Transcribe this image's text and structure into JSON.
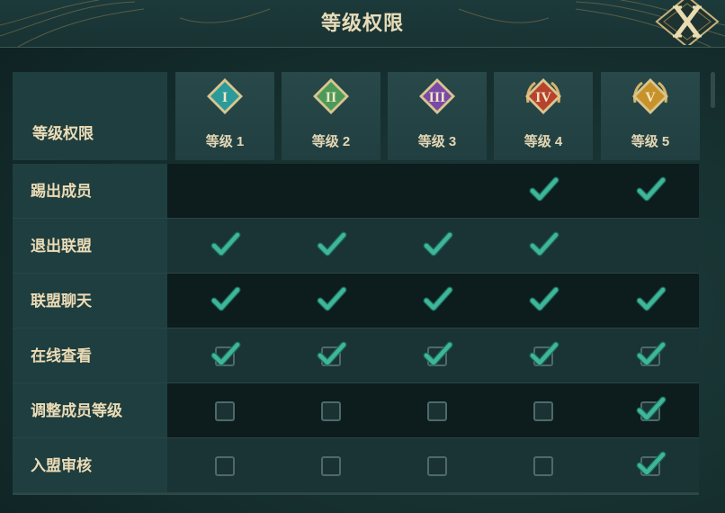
{
  "title": "等级权限",
  "close_label": "X",
  "header_label": "等级权限",
  "levels": [
    {
      "label": "等级 1",
      "numeral": "I",
      "color": "#2a9a9a"
    },
    {
      "label": "等级 2",
      "numeral": "II",
      "color": "#4c9a5a"
    },
    {
      "label": "等级 3",
      "numeral": "III",
      "color": "#7a4aa6"
    },
    {
      "label": "等级 4",
      "numeral": "IV",
      "color": "#b7432d"
    },
    {
      "label": "等级 5",
      "numeral": "V",
      "color": "#c8922b"
    }
  ],
  "permissions": [
    {
      "label": "踢出成员",
      "cells": [
        "none",
        "none",
        "none",
        "check",
        "check"
      ]
    },
    {
      "label": "退出联盟",
      "cells": [
        "check",
        "check",
        "check",
        "check",
        "none"
      ]
    },
    {
      "label": "联盟聊天",
      "cells": [
        "check",
        "check",
        "check",
        "check",
        "check"
      ]
    },
    {
      "label": "在线查看",
      "cells": [
        "boxcheck",
        "boxcheck",
        "boxcheck",
        "boxcheck",
        "boxcheck"
      ]
    },
    {
      "label": "调整成员等级",
      "cells": [
        "box",
        "box",
        "box",
        "box",
        "boxcheck"
      ]
    },
    {
      "label": "入盟审核",
      "cells": [
        "box",
        "box",
        "box",
        "box",
        "boxcheck"
      ]
    }
  ],
  "colors": {
    "check": "#3fb69a",
    "gold": "#d6b46a"
  },
  "icons": {
    "close": "close-x-icon",
    "check": "check-icon"
  }
}
